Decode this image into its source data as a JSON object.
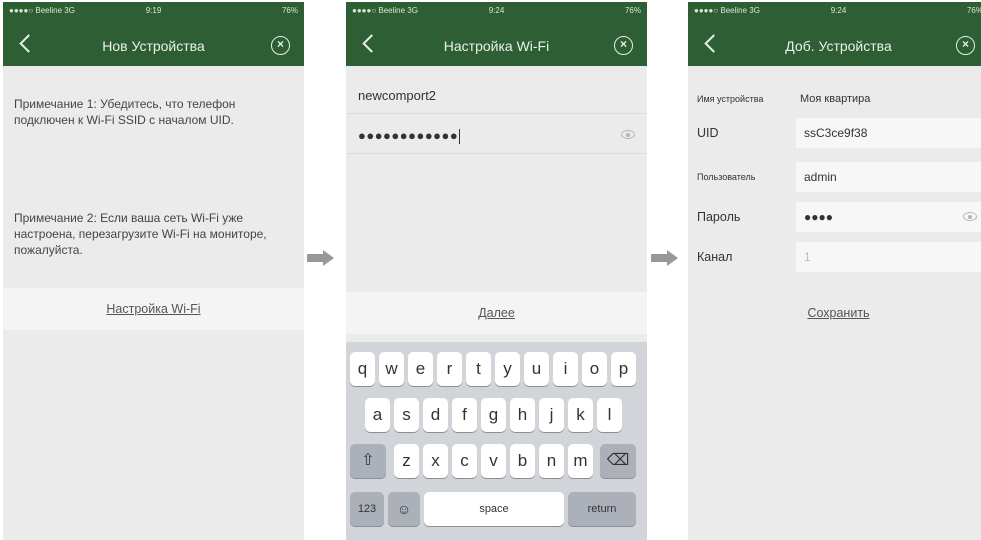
{
  "screens": [
    {
      "status": {
        "signal": "●●●●○ Beeline 3G",
        "time": "9:19",
        "battery": "76%"
      },
      "title": "Нов Устройства",
      "note1": "Примечание 1: Убедитесь, что телефон подключен к Wi-Fi SSID с началом UID.",
      "note2": "Примечание 2: Если ваша сеть Wi-Fi уже настроена, перезагрузите Wi-Fi на мониторе, пожалуйста.",
      "link": "Настройка Wi-Fi"
    },
    {
      "status": {
        "signal": "●●●●○ Beeline 3G",
        "time": "9:24",
        "battery": "76%"
      },
      "title": "Настройка Wi-Fi",
      "ssid": "newcomport2",
      "password": "●●●●●●●●●●●●",
      "next": "Далее",
      "keyboard": {
        "row1": [
          "q",
          "w",
          "e",
          "r",
          "t",
          "y",
          "u",
          "i",
          "o",
          "p"
        ],
        "row2": [
          "a",
          "s",
          "d",
          "f",
          "g",
          "h",
          "j",
          "k",
          "l"
        ],
        "row3": [
          "z",
          "x",
          "c",
          "v",
          "b",
          "n",
          "m"
        ],
        "shift": "⇧",
        "backspace": "⌫",
        "numbers": "123",
        "globe": "☺",
        "space": "space",
        "return": "return"
      }
    },
    {
      "status": {
        "signal": "●●●●○ Beeline 3G",
        "time": "9:24",
        "battery": "76%"
      },
      "title": "Доб. Устройства",
      "fields": {
        "name": {
          "label": "Имя устройства",
          "value": "Моя квартира"
        },
        "uid": {
          "label": "UID",
          "value": "ssC3ce9f38"
        },
        "user": {
          "label": "Пользователь",
          "value": "admin"
        },
        "password": {
          "label": "Пароль",
          "value": "●●●●"
        },
        "channel": {
          "label": "Канал",
          "value": "1"
        }
      },
      "save": "Сохранить"
    }
  ],
  "colors": {
    "header": "#2e5e33",
    "screen_bg": "#ebebeb",
    "arrow": "#999999"
  },
  "icons": [
    "chevron-left-icon",
    "close-circle-icon",
    "eye-icon",
    "arrow-right-icon"
  ]
}
